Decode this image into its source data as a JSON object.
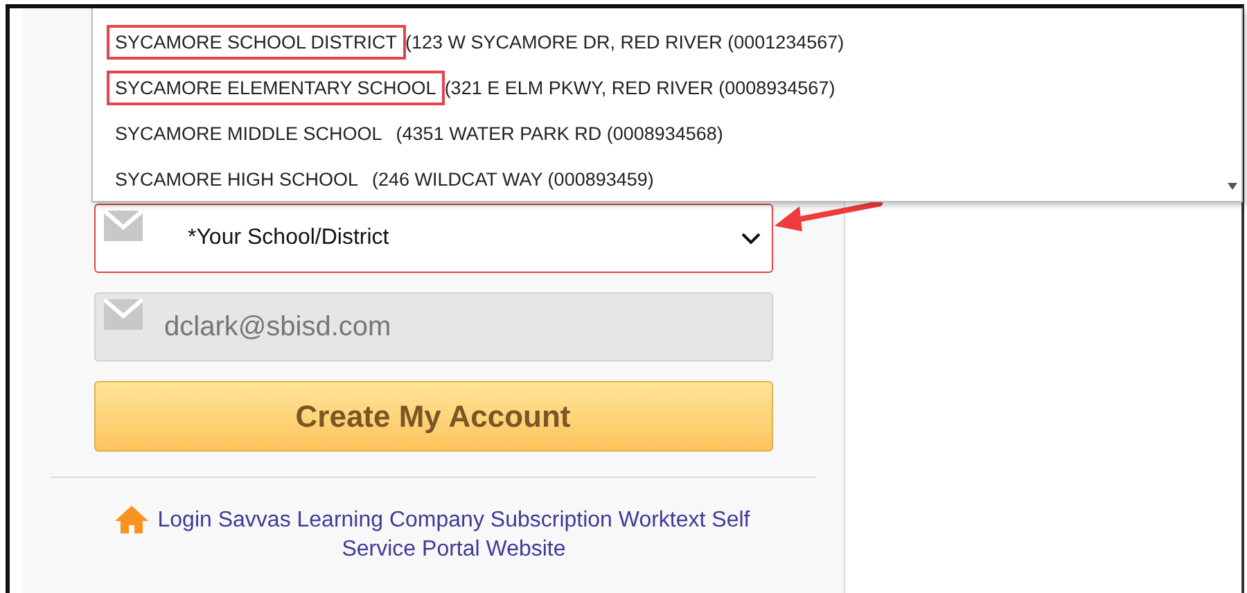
{
  "school_dropdown": {
    "options": [
      {
        "name": "SYCAMORE SCHOOL DISTRICT",
        "detail": "(123 W SYCAMORE DR, RED RIVER (0001234567)",
        "highlighted": true
      },
      {
        "name": "SYCAMORE ELEMENTARY SCHOOL",
        "detail": "(321 E ELM PKWY, RED RIVER (0008934567)",
        "highlighted": true
      },
      {
        "name": "SYCAMORE MIDDLE SCHOOL",
        "detail": "(4351 WATER PARK RD (0008934568)",
        "highlighted": false
      },
      {
        "name": "SYCAMORE HIGH SCHOOL",
        "detail": "(246 WILDCAT WAY (000893459)",
        "highlighted": false
      }
    ]
  },
  "school_select": {
    "value": "*Your School/District",
    "invalid": true
  },
  "email_field": {
    "value": "dclark@sbisd.com",
    "disabled": true
  },
  "create_button": {
    "label": "Create My Account"
  },
  "portal_link": {
    "label": "Login Savvas Learning Company Subscription Worktext Self Service Portal Website"
  }
}
